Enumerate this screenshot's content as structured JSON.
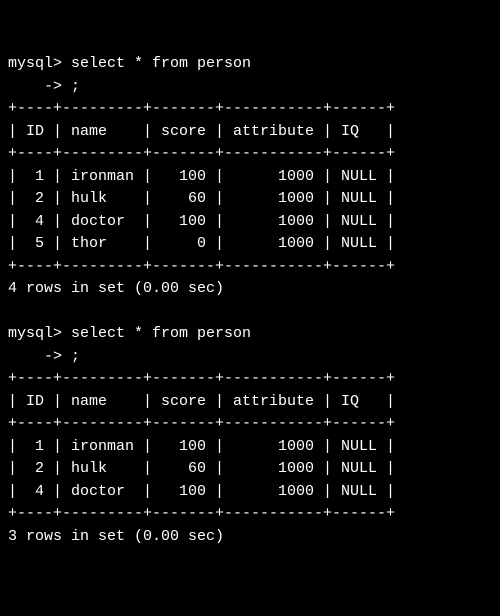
{
  "block1": {
    "prompt": "mysql> select * from person",
    "cont": "    -> ;",
    "border": "+----+---------+-------+-----------+------+",
    "header": "| ID | name    | score | attribute | IQ   |",
    "rows": [
      "|  1 | ironman |   100 |      1000 | NULL |",
      "|  2 | hulk    |    60 |      1000 | NULL |",
      "|  4 | doctor  |   100 |      1000 | NULL |",
      "|  5 | thor    |     0 |      1000 | NULL |"
    ],
    "status": "4 rows in set (0.00 sec)"
  },
  "block2": {
    "prompt": "mysql> select * from person",
    "cont": "    -> ;",
    "border": "+----+---------+-------+-----------+------+",
    "header": "| ID | name    | score | attribute | IQ   |",
    "rows": [
      "|  1 | ironman |   100 |      1000 | NULL |",
      "|  2 | hulk    |    60 |      1000 | NULL |",
      "|  4 | doctor  |   100 |      1000 | NULL |"
    ],
    "status": "3 rows in set (0.00 sec)"
  },
  "chart_data": [
    {
      "type": "table",
      "title": "person (query 1)",
      "columns": [
        "ID",
        "name",
        "score",
        "attribute",
        "IQ"
      ],
      "rows": [
        [
          1,
          "ironman",
          100,
          1000,
          null
        ],
        [
          2,
          "hulk",
          60,
          1000,
          null
        ],
        [
          4,
          "doctor",
          100,
          1000,
          null
        ],
        [
          5,
          "thor",
          0,
          1000,
          null
        ]
      ],
      "row_count": 4,
      "elapsed_sec": 0.0
    },
    {
      "type": "table",
      "title": "person (query 2)",
      "columns": [
        "ID",
        "name",
        "score",
        "attribute",
        "IQ"
      ],
      "rows": [
        [
          1,
          "ironman",
          100,
          1000,
          null
        ],
        [
          2,
          "hulk",
          60,
          1000,
          null
        ],
        [
          4,
          "doctor",
          100,
          1000,
          null
        ]
      ],
      "row_count": 3,
      "elapsed_sec": 0.0
    }
  ]
}
